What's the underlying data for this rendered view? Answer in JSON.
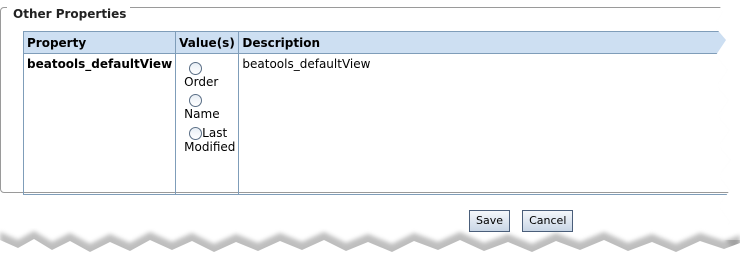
{
  "section": {
    "legend": "Other Properties"
  },
  "table": {
    "headers": [
      "Property",
      "Value(s)",
      "Description"
    ],
    "row": {
      "property": "beatools_defaultView",
      "options": [
        "Order",
        "Name",
        "Last",
        "Modified"
      ],
      "description": "beatools_defaultView"
    }
  },
  "buttons": {
    "save_label": "Save",
    "cancel_label": "Cancel"
  }
}
